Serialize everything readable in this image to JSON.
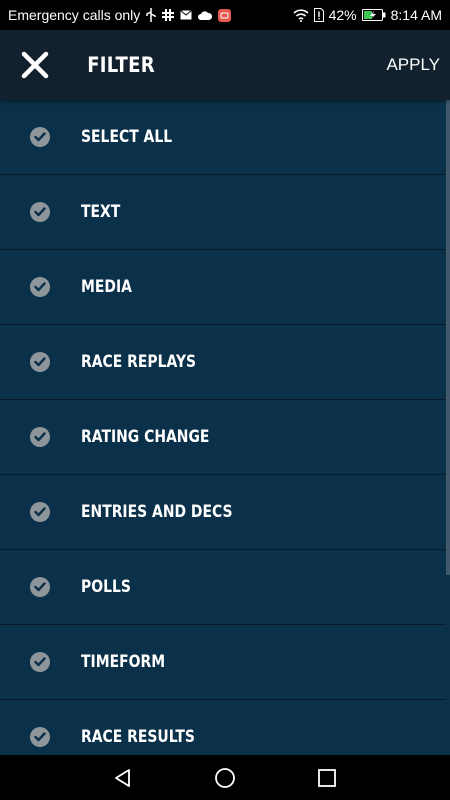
{
  "status_bar": {
    "carrier_text": "Emergency calls only",
    "battery_percent": "42%",
    "time": "8:14 AM"
  },
  "header": {
    "title": "FILTER",
    "apply_label": "APPLY"
  },
  "filters": [
    {
      "label": "SELECT ALL",
      "checked": true
    },
    {
      "label": "TEXT",
      "checked": true
    },
    {
      "label": "MEDIA",
      "checked": true
    },
    {
      "label": "RACE REPLAYS",
      "checked": true
    },
    {
      "label": "RATING CHANGE",
      "checked": true
    },
    {
      "label": "ENTRIES AND DECS",
      "checked": true
    },
    {
      "label": "POLLS",
      "checked": true
    },
    {
      "label": "TIMEFORM",
      "checked": true
    },
    {
      "label": "RACE RESULTS",
      "checked": true
    }
  ],
  "colors": {
    "header_bg": "#13212f",
    "list_bg": "#0b3049",
    "divider": "#061a28",
    "check_bg": "#8f969b"
  }
}
